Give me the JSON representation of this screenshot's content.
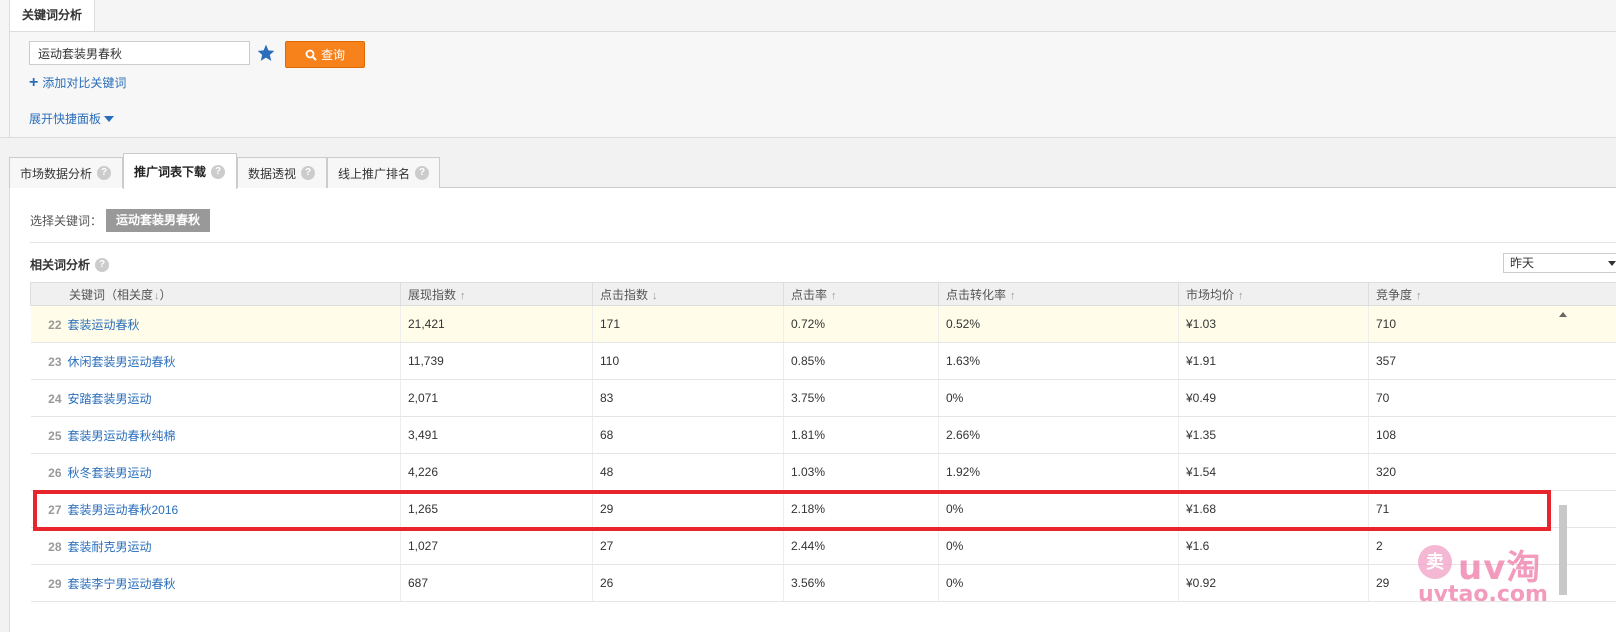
{
  "top_tab": {
    "label": "关键词分析"
  },
  "search": {
    "value": "运动套装男春秋",
    "button_label": "查询"
  },
  "add_compare": {
    "label": "添加对比关键词"
  },
  "expand_panel": {
    "label": "展开快捷面板"
  },
  "tabs": [
    {
      "label": "市场数据分析",
      "active": false
    },
    {
      "label": "推广词表下载",
      "active": true
    },
    {
      "label": "数据透视",
      "active": false
    },
    {
      "label": "线上推广排名",
      "active": false
    }
  ],
  "selected_keyword": {
    "label": "选择关键词：",
    "tag": "运动套装男春秋"
  },
  "related": {
    "title": "相关词分析",
    "date_value": "昨天"
  },
  "table": {
    "headers": [
      {
        "label": "关键词（相关度",
        "suffix": "）"
      },
      {
        "label": "展现指数"
      },
      {
        "label": "点击指数"
      },
      {
        "label": "点击率"
      },
      {
        "label": "点击转化率"
      },
      {
        "label": "市场均价"
      },
      {
        "label": "竞争度"
      }
    ],
    "rows": [
      {
        "rank": "22",
        "keyword": "套装运动春秋",
        "impressions": "21,421",
        "clicks": "171",
        "ctr": "0.72%",
        "cvr": "0.52%",
        "price": "¥1.03",
        "competition": "710"
      },
      {
        "rank": "23",
        "keyword": "休闲套装男运动春秋",
        "impressions": "11,739",
        "clicks": "110",
        "ctr": "0.85%",
        "cvr": "1.63%",
        "price": "¥1.91",
        "competition": "357"
      },
      {
        "rank": "24",
        "keyword": "安踏套装男运动",
        "impressions": "2,071",
        "clicks": "83",
        "ctr": "3.75%",
        "cvr": "0%",
        "price": "¥0.49",
        "competition": "70"
      },
      {
        "rank": "25",
        "keyword": "套装男运动春秋纯棉",
        "impressions": "3,491",
        "clicks": "68",
        "ctr": "1.81%",
        "cvr": "2.66%",
        "price": "¥1.35",
        "competition": "108"
      },
      {
        "rank": "26",
        "keyword": "秋冬套装男运动",
        "impressions": "4,226",
        "clicks": "48",
        "ctr": "1.03%",
        "cvr": "1.92%",
        "price": "¥1.54",
        "competition": "320"
      },
      {
        "rank": "27",
        "keyword": "套装男运动春秋2016",
        "impressions": "1,265",
        "clicks": "29",
        "ctr": "2.18%",
        "cvr": "0%",
        "price": "¥1.68",
        "competition": "71"
      },
      {
        "rank": "28",
        "keyword": "套装耐克男运动",
        "impressions": "1,027",
        "clicks": "27",
        "ctr": "2.44%",
        "cvr": "0%",
        "price": "¥1.6",
        "competition": "2"
      },
      {
        "rank": "29",
        "keyword": "套装李宁男运动春秋",
        "impressions": "687",
        "clicks": "26",
        "ctr": "3.56%",
        "cvr": "0%",
        "price": "¥0.92",
        "competition": "29"
      }
    ]
  },
  "watermark": {
    "seal": "卖",
    "big": "uv淘",
    "small": "uvtao.com"
  },
  "colors": {
    "accent_orange": "#f7821c",
    "link_blue": "#2a6ebb",
    "highlight_red": "#e8242d",
    "watermark_pink": "#ee7aa8"
  }
}
